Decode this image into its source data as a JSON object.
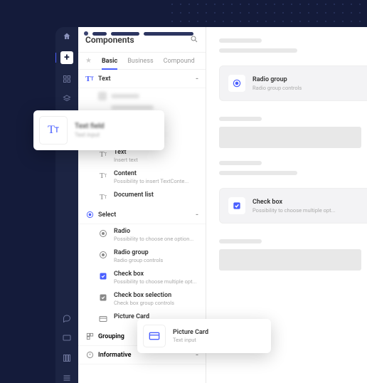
{
  "panel": {
    "title": "Components",
    "tabs": [
      "Basic",
      "Business",
      "Compound"
    ],
    "activeTab": 0,
    "sections": {
      "text": {
        "label": "Text",
        "color": "#4a5fff",
        "items": [
          {
            "title": "Text",
            "desc": "Insert text"
          },
          {
            "title": "Content",
            "desc": "Possibility to insert TextConte..."
          },
          {
            "title": "Document list",
            "desc": ""
          }
        ]
      },
      "select": {
        "label": "Select",
        "color": "#4a5fff",
        "items": [
          {
            "title": "Radio",
            "desc": "Possibility to choose one option..."
          },
          {
            "title": "Radio group",
            "desc": "Radio group controls"
          },
          {
            "title": "Check box",
            "desc": "Possibility to choose multiple opt..."
          },
          {
            "title": "Check box selection",
            "desc": "Check box group controls"
          },
          {
            "title": "Picture Card",
            "desc": ""
          }
        ]
      },
      "grouping": {
        "label": "Grouping"
      },
      "informative": {
        "label": "Informative"
      }
    }
  },
  "canvas": {
    "radioCard": {
      "title": "Radio group",
      "desc": "Radio group controls"
    },
    "checkCard": {
      "title": "Check box",
      "desc": "Possibility to choose multiple opt..."
    }
  },
  "floats": {
    "textField": {
      "title": "Text field",
      "desc": "Text input"
    },
    "pictureCard": {
      "title": "Picture Card",
      "desc": "Text input"
    }
  }
}
